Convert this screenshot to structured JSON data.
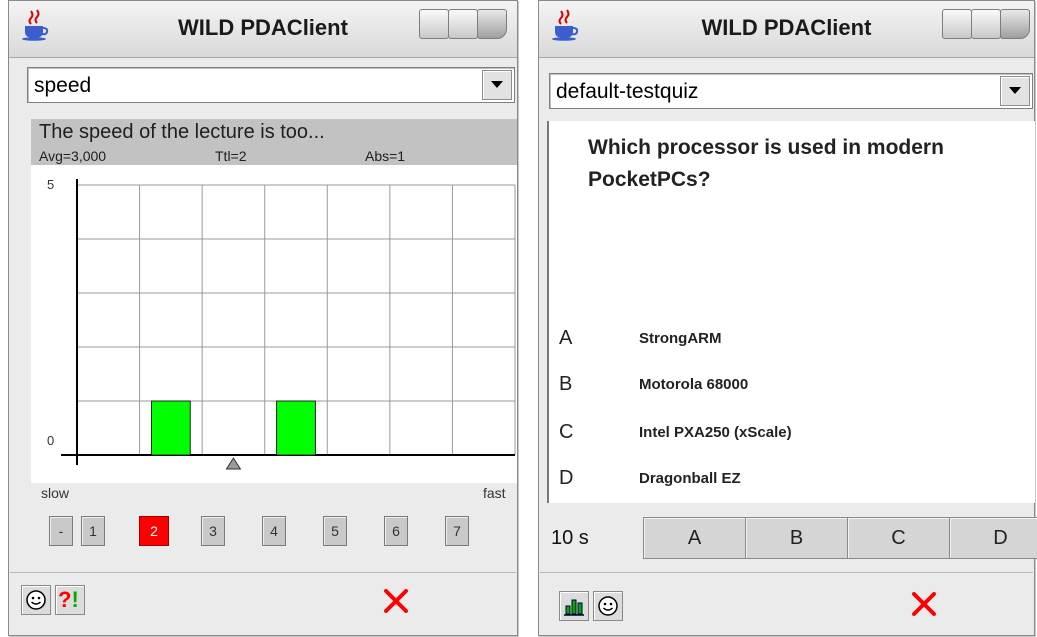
{
  "left_window": {
    "title": "WILD PDAClient",
    "app_icon": "java-coffee-cup-icon",
    "category_select": {
      "value": "speed"
    },
    "question": {
      "text": "The speed of the lecture is too...",
      "avg": "Avg=3,000",
      "total": "Ttl=2",
      "abstain": "Abs=1"
    },
    "scale": {
      "min_label": "slow",
      "max_label": "fast"
    },
    "vote_buttons": [
      "-",
      "1",
      "2",
      "3",
      "4",
      "5",
      "6",
      "7"
    ],
    "selected_vote": "2",
    "toolbar": {
      "smiley_icon": "smiley-icon",
      "alert_label": "?!",
      "close_icon": "close-x-icon"
    },
    "colors": {
      "bar": "#00ff00",
      "selected_vote": "#ff0000",
      "close": "#ff0000",
      "alert": "#ff0000",
      "alert_bang": "#00aa00"
    }
  },
  "chart_data": {
    "type": "bar",
    "categories": [
      "1",
      "2",
      "3",
      "4",
      "5",
      "6",
      "7"
    ],
    "values": [
      0,
      1,
      0,
      1,
      0,
      0,
      0
    ],
    "ylim": [
      0,
      5
    ],
    "y_tick_labels": [
      "0",
      "5"
    ],
    "grid": true,
    "mean_marker": 3.0,
    "xlabel": "",
    "ylabel": "",
    "title": ""
  },
  "right_window": {
    "title": "WILD PDAClient",
    "app_icon": "java-coffee-cup-icon",
    "quiz_select": {
      "value": "default-testquiz"
    },
    "question": "Which processor is used in modern PocketPCs?",
    "options": [
      {
        "letter": "A",
        "text": "StrongARM"
      },
      {
        "letter": "B",
        "text": "Motorola 68000"
      },
      {
        "letter": "C",
        "text": "Intel PXA250 (xScale)"
      },
      {
        "letter": "D",
        "text": "Dragonball EZ"
      }
    ],
    "timer": "10 s",
    "answer_buttons": [
      "A",
      "B",
      "C",
      "D"
    ],
    "toolbar": {
      "chart_icon": "bar-chart-icon",
      "smiley_icon": "smiley-icon",
      "close_icon": "close-x-icon"
    }
  }
}
